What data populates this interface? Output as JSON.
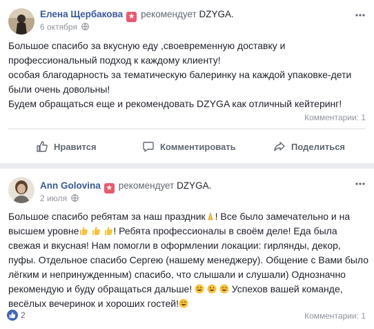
{
  "posts": [
    {
      "author": "Елена Щербакова",
      "recommends": "рекомендует",
      "page": "DZYGA.",
      "date": "6 октября",
      "lines": [
        "Большое спасибо за вкусную еду ,своевременную доставку и",
        "профессиональный подход к каждому клиенту!",
        "особая благодарность за тематическую балеринку на каждой упаковке-дети",
        "были очень довольны!",
        "Будем обращаться еще и рекомендовать DZYGA как отличный кейтеринг!"
      ],
      "comments": "Комментарии: 1",
      "actions": {
        "like": "Нравится",
        "comment": "Комментировать",
        "share": "Поделиться"
      }
    },
    {
      "author": "Ann Golovina",
      "recommends": "рекомендует",
      "page": "DZYGA.",
      "date": "2 июля",
      "lines": [
        {
          "a": "Большое спасибо ребятам за наш праздник",
          "b": "! Все было замечательно и на"
        },
        {
          "a": "высшем уровне",
          "b": "! Ребята профессионалы в своём деле! Еда была"
        },
        "свежая и вкусная! Нам помогли в оформлении локации: гирлянды, декор,",
        "пуфы. Отдельное спасибо Сергею (нашему менеджеру). Общение с Вами было",
        "лёгким и непринужденным) спасибо, что слышали и слушали) Однозначно",
        {
          "a": "рекомендую и буду обращаться дальше! ",
          "b": " Успехов вашей команде,"
        },
        {
          "a": "весёлых вечеринок и хороших гостей!",
          "b": ""
        }
      ],
      "reactions": "2",
      "comments": "Комментарии: 1"
    }
  ],
  "icons": {
    "recommend": "recommend-star-icon",
    "globe": "globe-icon",
    "more": "more-dots-icon",
    "like": "thumbs-up-icon",
    "comment": "comment-bubble-icon",
    "share": "share-arrow-icon",
    "pray": "pray-emoji",
    "thumbs": "thumbs-up-emoji",
    "grin": "grinning-emoji",
    "smile": "smiling-emoji"
  },
  "colors": {
    "author": "#385898",
    "badge": "#e65a6e",
    "like": "#4267b2",
    "muted": "#90949c"
  }
}
